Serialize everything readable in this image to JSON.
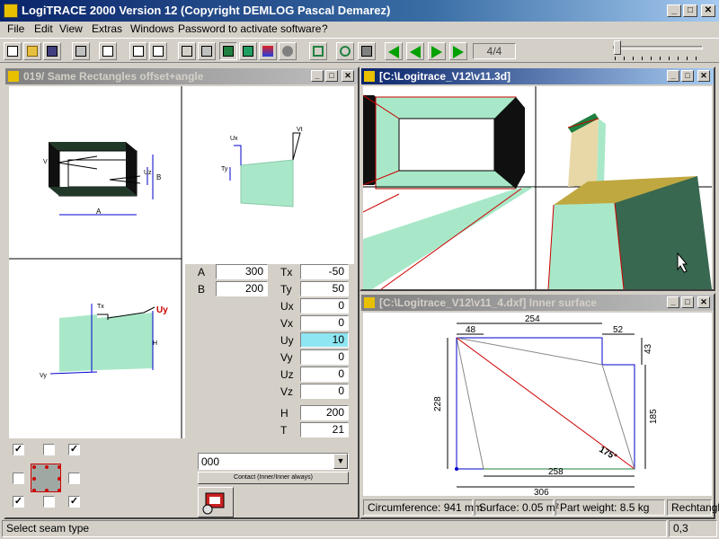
{
  "app": {
    "title": "LogiTRACE 2000  Version 12  (Copyright DEMLOG Pascal Demarez)"
  },
  "menu": [
    "File",
    "Edit",
    "View",
    "Extras",
    "Windows",
    "Password to activate software",
    "?"
  ],
  "toolbar": {
    "page_counter": "4/4"
  },
  "left_window": {
    "title": "019/ Same Rectangles offset+angle"
  },
  "params": {
    "A": {
      "label": "A",
      "value": "300"
    },
    "B": {
      "label": "B",
      "value": "200"
    },
    "Tx": {
      "label": "Tx",
      "value": "-50"
    },
    "Ty": {
      "label": "Ty",
      "value": "50"
    },
    "Ux": {
      "label": "Ux",
      "value": "0"
    },
    "Vx": {
      "label": "Vx",
      "value": "0"
    },
    "Uy": {
      "label": "Uy",
      "value": "10"
    },
    "Vy": {
      "label": "Vy",
      "value": "0"
    },
    "Uz": {
      "label": "Uz",
      "value": "0"
    },
    "Vz": {
      "label": "Vz",
      "value": "0"
    },
    "H": {
      "label": "H",
      "value": "200"
    },
    "T": {
      "label": "T",
      "value": "21"
    }
  },
  "combo": {
    "value": "000"
  },
  "contact_button": "Contact (Inner/Inner always)",
  "diagram_labels": {
    "A": "A",
    "B": "B",
    "V": "V",
    "Uz": "Uz",
    "Ux": "Ux",
    "Vt": "Vt",
    "Ty": "Ty",
    "Tx": "Tx",
    "Uy": "Uy",
    "H": "H",
    "Vy": "Vy"
  },
  "top_right_window": {
    "title": "[C:\\Logitrace_V12\\v11.3d]"
  },
  "bottom_right_window": {
    "title": "[C:\\Logitrace_V12\\v11_4.dxf]  Inner surface",
    "dims": {
      "d254": "254",
      "d48": "48",
      "d52": "52",
      "d43": "43",
      "d228": "228",
      "d185": "185",
      "d258": "258",
      "d306": "306",
      "angle": "175°"
    },
    "info": {
      "circumference": "Circumference: 941 mm",
      "surface": "Surface: 0.05 m²",
      "weight": "Part weight: 8.5 kg",
      "shape": "Rechtangle"
    }
  },
  "status": {
    "message": "Select seam type",
    "value": "0,3"
  },
  "colors": {
    "mesh_fill": "#a8e8c8",
    "outline_red": "#cc0000",
    "blue": "#0000cc"
  }
}
